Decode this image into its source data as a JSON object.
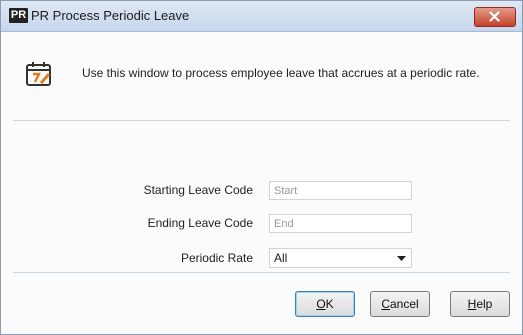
{
  "window": {
    "app_badge": "PR",
    "title": "PR Process Periodic Leave"
  },
  "header": {
    "description": "Use this window to process employee leave that accrues at a periodic rate."
  },
  "form": {
    "starting_label": "Starting Leave Code",
    "starting_placeholder": "Start",
    "ending_label": "Ending Leave Code",
    "ending_placeholder": "End",
    "rate_label": "Periodic Rate",
    "rate_value": "All"
  },
  "buttons": {
    "ok_first": "O",
    "ok_rest": "K",
    "cancel_first": "C",
    "cancel_rest": "ancel",
    "help_first": "H",
    "help_rest": "elp"
  }
}
